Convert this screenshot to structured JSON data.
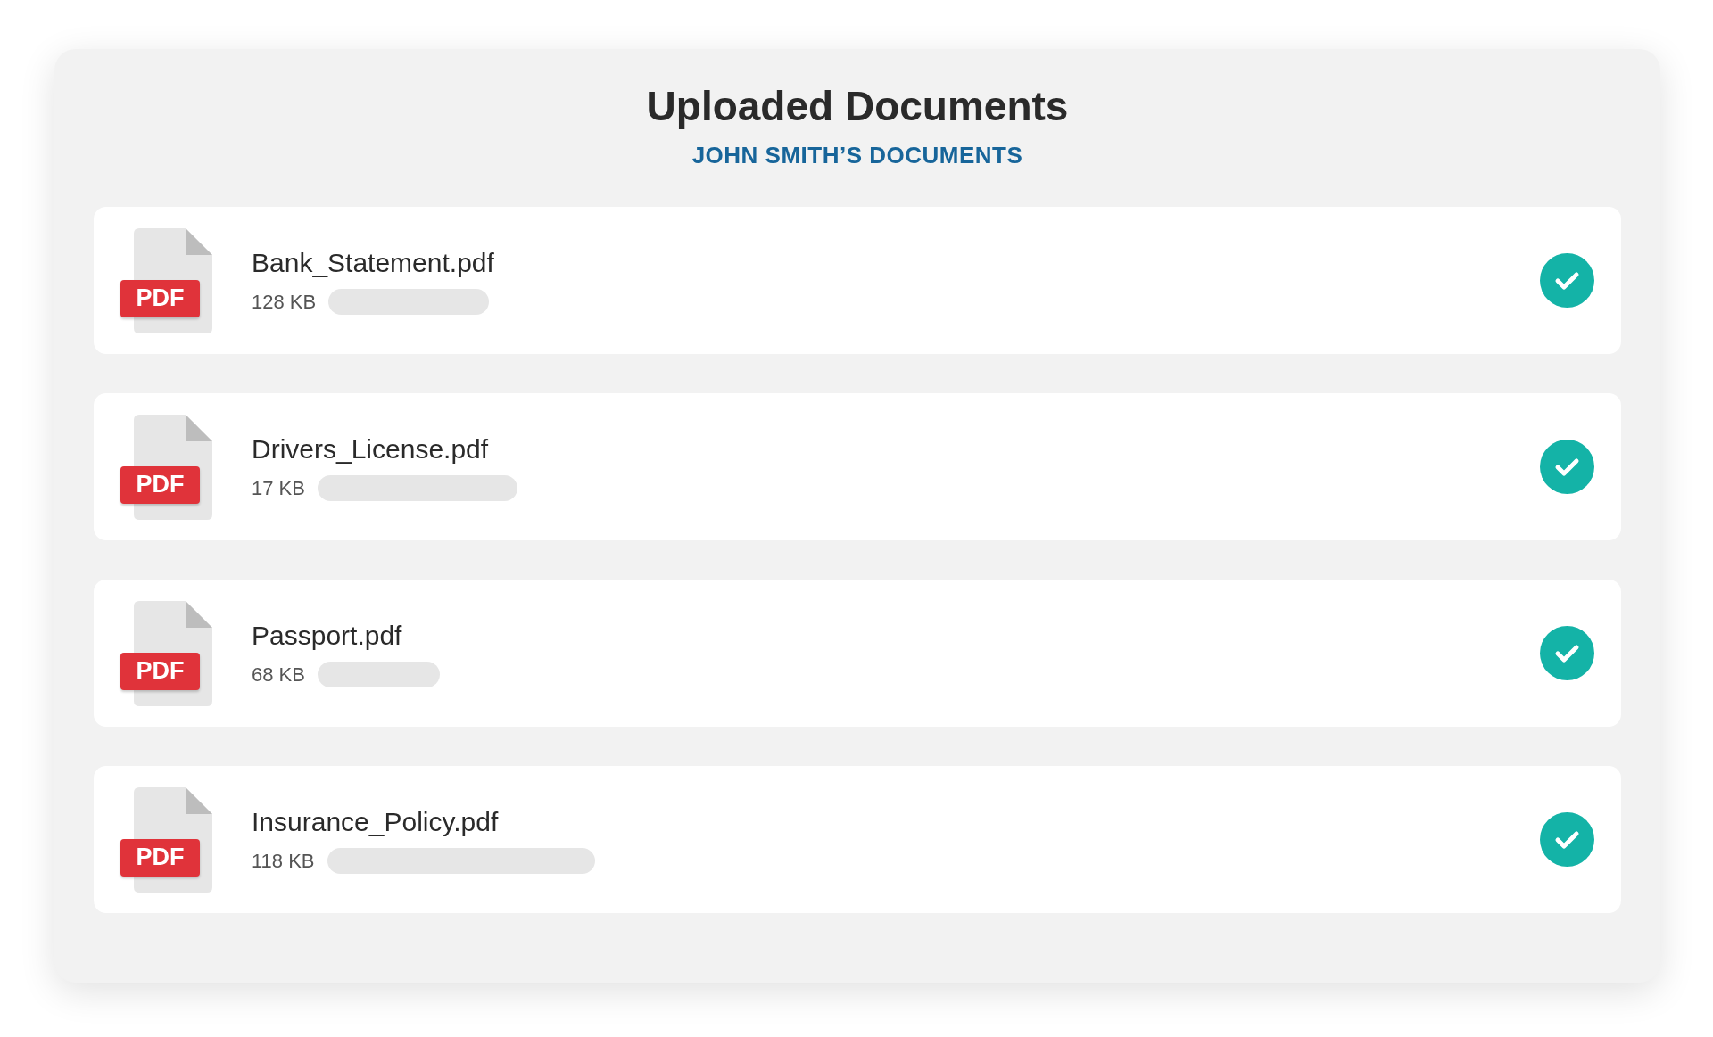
{
  "header": {
    "title": "Uploaded Documents",
    "subtitle": "JOHN SMITH’S DOCUMENTS"
  },
  "documents": [
    {
      "file_type": "PDF",
      "name": "Bank_Statement.pdf",
      "size": "128 KB",
      "uploaded": true
    },
    {
      "file_type": "PDF",
      "name": "Drivers_License.pdf",
      "size": "17 KB",
      "uploaded": true
    },
    {
      "file_type": "PDF",
      "name": "Passport.pdf",
      "size": "68 KB",
      "uploaded": true
    },
    {
      "file_type": "PDF",
      "name": "Insurance_Policy.pdf",
      "size": "118 KB",
      "uploaded": true
    }
  ]
}
